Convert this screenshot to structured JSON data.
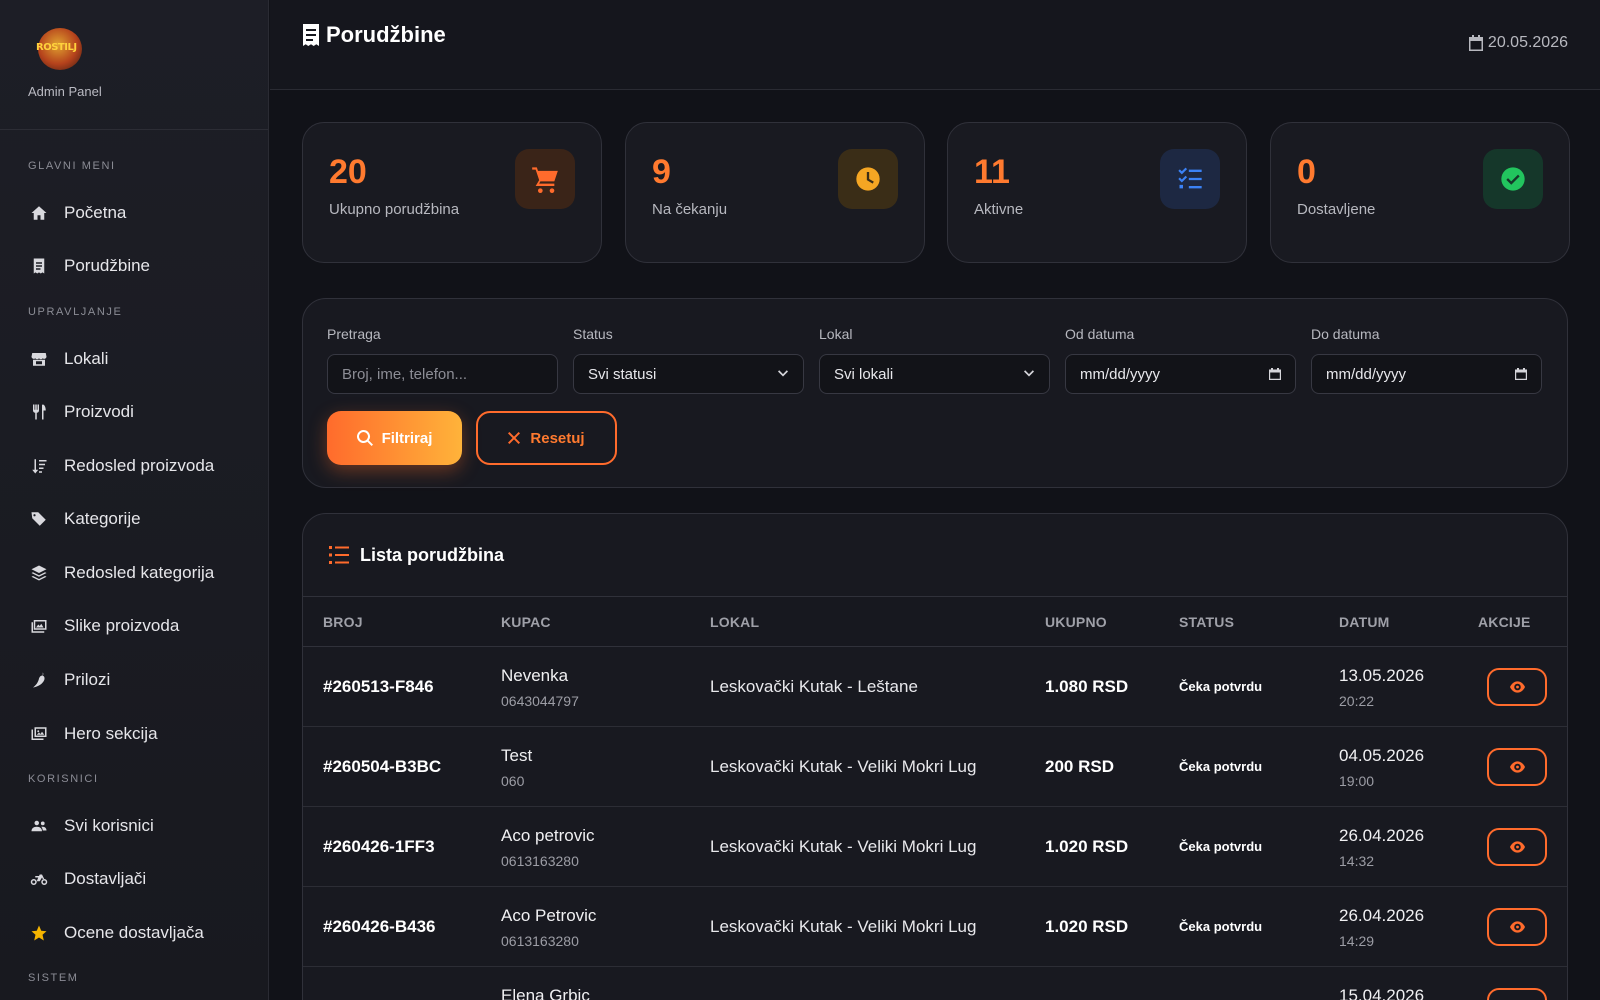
{
  "brand": {
    "logo_text": "ROSTILJ",
    "subtitle": "Admin Panel"
  },
  "sidebar": {
    "sections": [
      "GLAVNI MENI",
      "UPRAVLJANJE",
      "KORISNICI",
      "SISTEM"
    ],
    "items": [
      {
        "label": "Početna",
        "icon": "home-icon"
      },
      {
        "label": "Porudžbine",
        "icon": "receipt-icon"
      },
      {
        "label": "Lokali",
        "icon": "store-icon"
      },
      {
        "label": "Proizvodi",
        "icon": "utensils-icon"
      },
      {
        "label": "Redosled proizvoda",
        "icon": "sort-icon"
      },
      {
        "label": "Kategorije",
        "icon": "tags-icon"
      },
      {
        "label": "Redosled kategorija",
        "icon": "layers-icon"
      },
      {
        "label": "Slike proizvoda",
        "icon": "images-icon"
      },
      {
        "label": "Prilozi",
        "icon": "pepper-icon"
      },
      {
        "label": "Hero sekcija",
        "icon": "photo-icon"
      },
      {
        "label": "Svi korisnici",
        "icon": "users-icon"
      },
      {
        "label": "Dostavljači",
        "icon": "motorcycle-icon"
      },
      {
        "label": "Ocene dostavljača",
        "icon": "star-icon"
      }
    ]
  },
  "header": {
    "title": "Porudžbine",
    "date": "20.05.2026"
  },
  "stats": [
    {
      "value": "20",
      "label": "Ukupno porudžbina",
      "icon": "cart-icon",
      "color": "#ff6b2c"
    },
    {
      "value": "9",
      "label": "Na čekanju",
      "icon": "clock-icon",
      "color": "#f5a623"
    },
    {
      "value": "11",
      "label": "Aktivne",
      "icon": "list-check-icon",
      "color": "#3b82f6"
    },
    {
      "value": "0",
      "label": "Dostavljene",
      "icon": "check-circle-icon",
      "color": "#22c55e"
    }
  ],
  "filters": {
    "search_label": "Pretraga",
    "search_placeholder": "Broj, ime, telefon...",
    "status_label": "Status",
    "status_value": "Svi statusi",
    "location_label": "Lokal",
    "location_value": "Svi lokali",
    "from_label": "Od datuma",
    "from_placeholder": "mm/dd/yyyy",
    "to_label": "Do datuma",
    "to_placeholder": "mm/dd/yyyy",
    "filter_button": "Filtriraj",
    "reset_button": "Resetuj"
  },
  "orders": {
    "title": "Lista porudžbina",
    "columns": [
      "BROJ",
      "KUPAC",
      "LOKAL",
      "UKUPNO",
      "STATUS",
      "DATUM",
      "AKCIJE"
    ],
    "rows": [
      {
        "number": "#260513-F846",
        "customer": "Nevenka",
        "phone": "0643044797",
        "location": "Leskovački Kutak - Leštane",
        "total": "1.080 RSD",
        "status": "Čeka potvrdu",
        "date": "13.05.2026",
        "time": "20:22"
      },
      {
        "number": "#260504-B3BC",
        "customer": "Test",
        "phone": "060",
        "location": "Leskovački Kutak - Veliki Mokri Lug",
        "total": "200 RSD",
        "status": "Čeka potvrdu",
        "date": "04.05.2026",
        "time": "19:00"
      },
      {
        "number": "#260426-1FF3",
        "customer": "Aco petrovic",
        "phone": "0613163280",
        "location": "Leskovački Kutak - Veliki Mokri Lug",
        "total": "1.020 RSD",
        "status": "Čeka potvrdu",
        "date": "26.04.2026",
        "time": "14:32"
      },
      {
        "number": "#260426-B436",
        "customer": "Aco Petrovic",
        "phone": "0613163280",
        "location": "Leskovački Kutak - Veliki Mokri Lug",
        "total": "1.020 RSD",
        "status": "Čeka potvrdu",
        "date": "26.04.2026",
        "time": "14:29"
      },
      {
        "number": "",
        "customer": "Elena Grbic",
        "phone": "",
        "location": "",
        "total": "",
        "status": "",
        "date": "15.04.2026",
        "time": ""
      }
    ]
  }
}
